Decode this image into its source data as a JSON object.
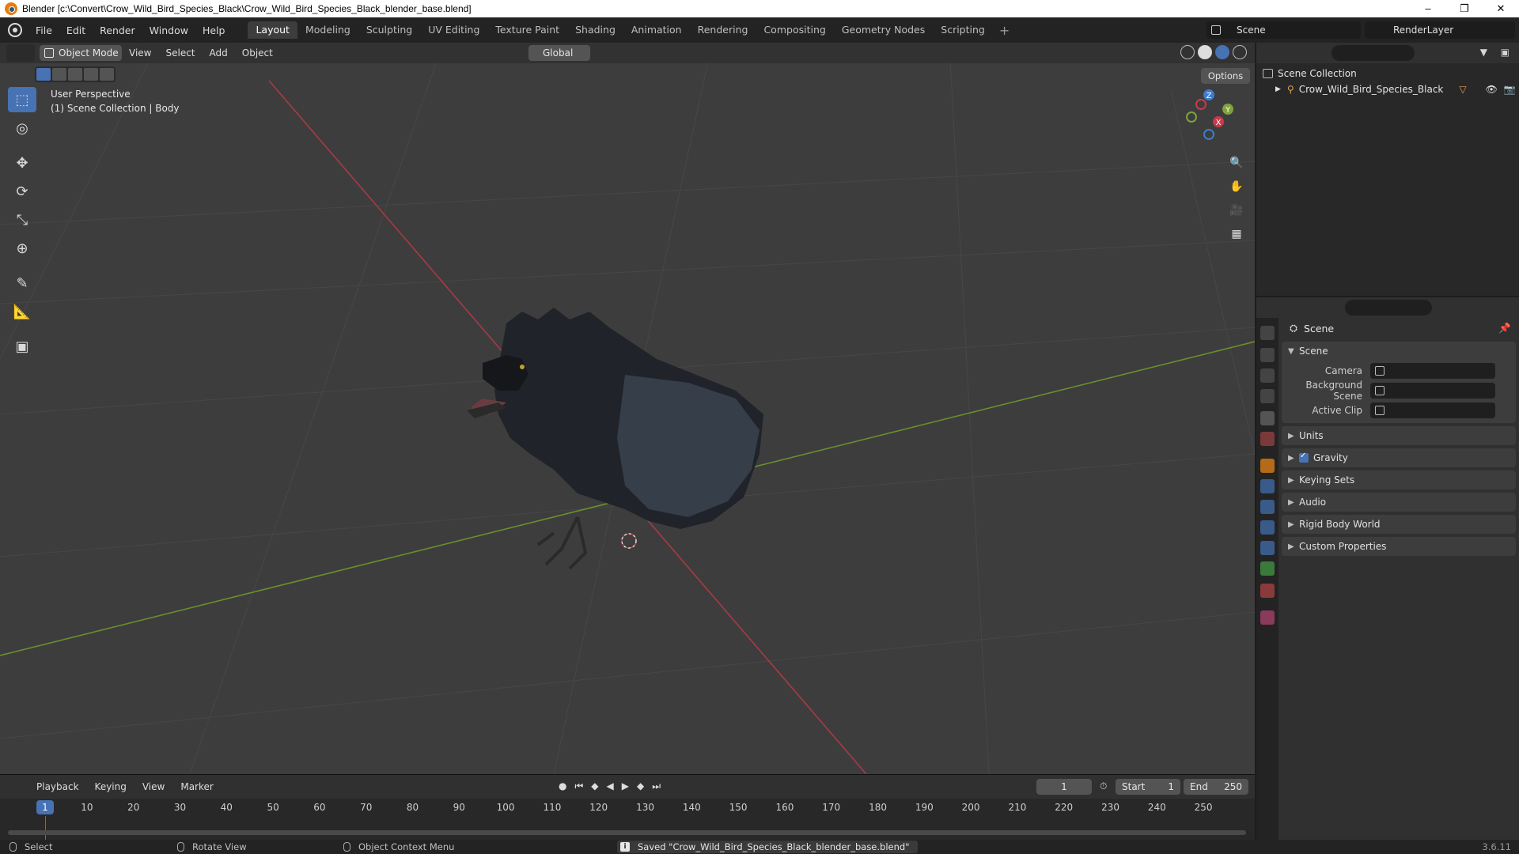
{
  "window": {
    "title": "Blender [c:\\Convert\\Crow_Wild_Bird_Species_Black\\Crow_Wild_Bird_Species_Black_blender_base.blend]"
  },
  "menu": {
    "items": [
      "File",
      "Edit",
      "Render",
      "Window",
      "Help"
    ]
  },
  "workspaces": {
    "tabs": [
      "Layout",
      "Modeling",
      "Sculpting",
      "UV Editing",
      "Texture Paint",
      "Shading",
      "Animation",
      "Rendering",
      "Compositing",
      "Geometry Nodes",
      "Scripting"
    ],
    "active": "Layout",
    "add_label": "+"
  },
  "scene_selector": {
    "value": "Scene"
  },
  "renderlayer_selector": {
    "value": "RenderLayer"
  },
  "viewport": {
    "mode": "Object Mode",
    "menus": [
      "View",
      "Select",
      "Add",
      "Object"
    ],
    "orientation": "Global",
    "options_label": "Options",
    "overlay_line1": "User Perspective",
    "overlay_line2": "(1) Scene Collection | Body",
    "gizmo_axes": {
      "z": "Z",
      "y": "Y",
      "x": "X"
    },
    "colors": {
      "x_axis": "#c93b4b",
      "y_axis": "#7fa33a",
      "z_axis": "#3f7ccc",
      "active": "#4772b3"
    }
  },
  "toolbar": {
    "tools": [
      "select-box-icon",
      "cursor-icon",
      "move-icon",
      "rotate-icon",
      "scale-icon",
      "transform-icon",
      "annotate-icon",
      "measure-icon",
      "add-cube-icon"
    ]
  },
  "timeline": {
    "menus": [
      "Playback",
      "Keying",
      "View",
      "Marker"
    ],
    "current_frame": "1",
    "start_label": "Start",
    "start_value": "1",
    "end_label": "End",
    "end_value": "250",
    "ticks": [
      "10",
      "20",
      "30",
      "40",
      "50",
      "60",
      "70",
      "80",
      "90",
      "100",
      "110",
      "120",
      "130",
      "140",
      "150",
      "160",
      "170",
      "180",
      "190",
      "200",
      "210",
      "220",
      "230",
      "240",
      "250"
    ],
    "playhead_label": "1"
  },
  "outliner": {
    "root": "Scene Collection",
    "object": "Crow_Wild_Bird_Species_Black"
  },
  "properties": {
    "breadcrumb": "Scene",
    "section": "Scene",
    "camera_label": "Camera",
    "background_scene_label": "Background Scene",
    "active_clip_label": "Active Clip",
    "panels": [
      "Units",
      "Gravity",
      "Keying Sets",
      "Audio",
      "Rigid Body World",
      "Custom Properties"
    ]
  },
  "statusbar": {
    "select": "Select",
    "rotate_view": "Rotate View",
    "context_menu": "Object Context Menu",
    "saved_message": "Saved \"Crow_Wild_Bird_Species_Black_blender_base.blend\"",
    "version": "3.6.11"
  }
}
